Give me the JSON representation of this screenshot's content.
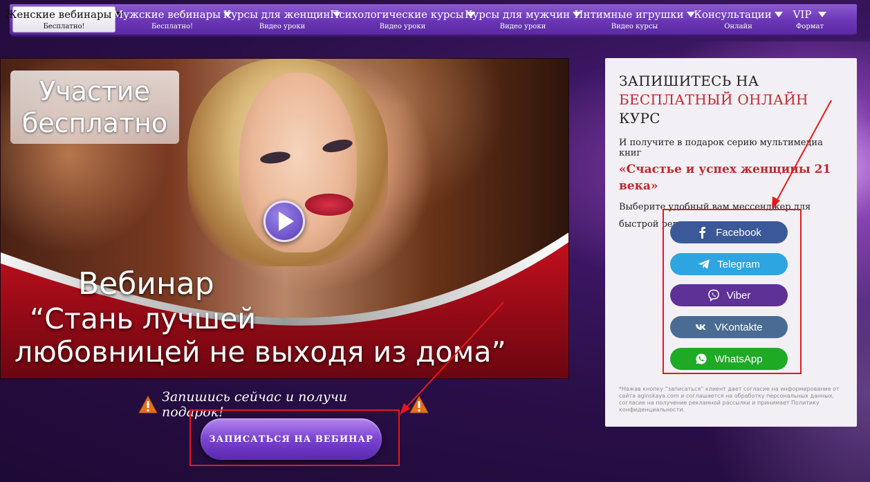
{
  "nav": {
    "items": [
      {
        "label": "Женские вебинары",
        "sub": "Бесплатно!",
        "active": true
      },
      {
        "label": "Мужские вебинары",
        "sub": "Бесплатно!"
      },
      {
        "label": "Курсы для женщин",
        "sub": "Видео уроки"
      },
      {
        "label": "Психологические курсы",
        "sub": "Видео уроки"
      },
      {
        "label": "Курсы для мужчин",
        "sub": "Видео уроки"
      },
      {
        "label": "Интимные игрушки",
        "sub": "Видео курсы"
      },
      {
        "label": "Консультации",
        "sub": "Онлайн"
      },
      {
        "label": "VIP",
        "sub": "Формат"
      }
    ]
  },
  "hero": {
    "badge_line1": "Участие",
    "badge_line2": "бесплатно",
    "title1": "Вебинар",
    "title2": "“Стань лучшей",
    "title3": "любовницей не выходя из дома”"
  },
  "cta": {
    "text": "Запишись сейчас и получи подарок!",
    "button": "ЗАПИСАТЬСЯ НА ВЕБИНАР"
  },
  "panel": {
    "h_part1": "ЗАПИШИТЕСЬ НА",
    "h_part2": "БЕСПЛАТНЫЙ ОНЛАЙН",
    "h_part3": "КУРС",
    "lead": "И получите в подарок серию мультимедиа книг",
    "book": "«Счастье и успех женщины 21 века»",
    "choose": "Выберите удобный вам мессенджер для быстрой регистрации",
    "messengers": [
      {
        "label": "Facebook",
        "icon": "facebook-icon",
        "color": "#3b5998"
      },
      {
        "label": "Telegram",
        "icon": "telegram-icon",
        "color": "#2ca5e0"
      },
      {
        "label": "Viber",
        "icon": "viber-icon",
        "color": "#665cac"
      },
      {
        "label": "VKontakte",
        "icon": "vk-icon",
        "color": "#4a76a8"
      },
      {
        "label": "WhatsApp",
        "icon": "whatsapp-icon",
        "color": "#25b93a"
      }
    ],
    "disclaimer": "*Нажав кнопку “записаться” клиент дает согласие на информирование от сайта aginskaya.com и соглашается на обработку персональных данных, согласие на получение рекламной рассылки и принимает Политику конфиденциальности."
  },
  "colors": {
    "nav": "#6a36b6",
    "accent_red": "#c0282e",
    "cta_button": "#7a42d0",
    "annotation": "#e81818"
  }
}
